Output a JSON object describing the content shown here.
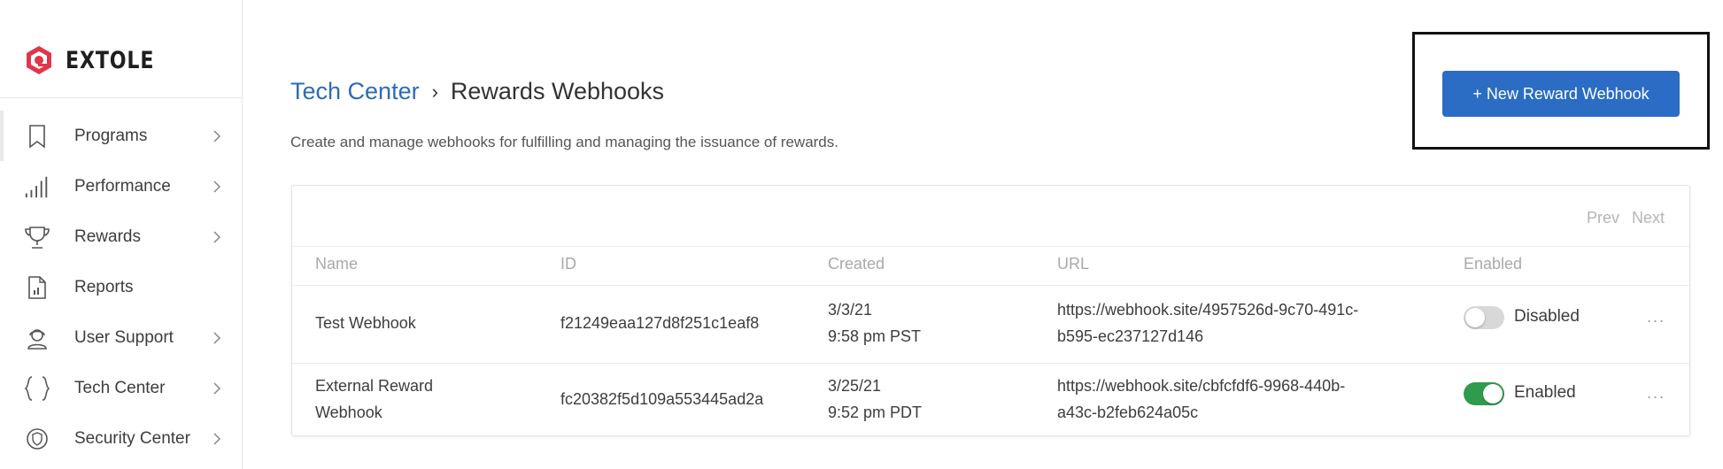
{
  "brand": {
    "name": "EXTOLE",
    "accent": "#e0364b"
  },
  "sidebar": {
    "items": [
      {
        "label": "Programs",
        "icon": "bookmark-icon",
        "has_chevron": true
      },
      {
        "label": "Performance",
        "icon": "signal-bars-icon",
        "has_chevron": true
      },
      {
        "label": "Rewards",
        "icon": "trophy-icon",
        "has_chevron": true
      },
      {
        "label": "Reports",
        "icon": "report-document-icon",
        "has_chevron": false
      },
      {
        "label": "User Support",
        "icon": "user-support-icon",
        "has_chevron": true
      },
      {
        "label": "Tech Center",
        "icon": "curly-braces-icon",
        "has_chevron": true
      },
      {
        "label": "Security Center",
        "icon": "shield-icon",
        "has_chevron": true
      }
    ]
  },
  "header": {
    "breadcrumb_parent": "Tech Center",
    "breadcrumb_separator": "›",
    "breadcrumb_current": "Rewards Webhooks",
    "subtitle": "Create and manage webhooks for fulfilling and managing the issuance of rewards.",
    "new_button_label": "+ New Reward Webhook"
  },
  "pager": {
    "prev": "Prev",
    "next": "Next"
  },
  "table": {
    "columns": [
      "Name",
      "ID",
      "Created",
      "URL",
      "Enabled"
    ],
    "rows": [
      {
        "name_line1": "Test Webhook",
        "name_line2": "",
        "id": "f21249eaa127d8f251c1eaf8",
        "created_date": "3/3/21",
        "created_time": "9:58 pm PST",
        "url_line1": "https://webhook.site/4957526d-9c70-491c-",
        "url_line2": "b595-ec237127d146",
        "enabled": false,
        "status_label": "Disabled",
        "more": "..."
      },
      {
        "name_line1": "External Reward",
        "name_line2": "Webhook",
        "id": "fc20382f5d109a553445ad2a",
        "created_date": "3/25/21",
        "created_time": "9:52 pm PDT",
        "url_line1": "https://webhook.site/cbfcfdf6-9968-440b-",
        "url_line2": "a43c-b2feb624a05c",
        "enabled": true,
        "status_label": "Enabled",
        "more": "..."
      }
    ]
  },
  "colors": {
    "link": "#2c6bb8",
    "primary_button": "#2b6cc4",
    "toggle_on": "#2f9b4c",
    "toggle_off": "#d8d8d8"
  }
}
